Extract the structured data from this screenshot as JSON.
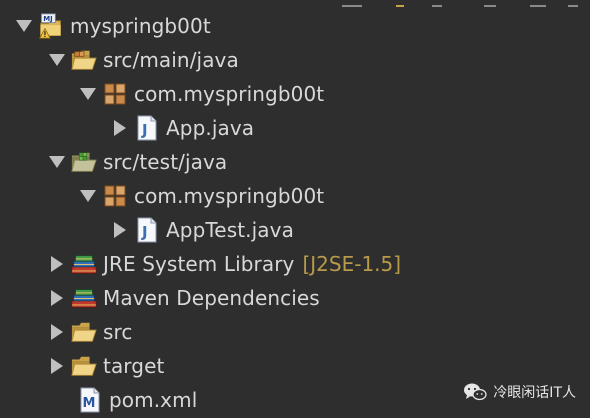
{
  "tree": {
    "project": {
      "label": "myspringb00t",
      "icon": "maven-project-warning-icon",
      "expanded": true
    },
    "src_main_java": {
      "label": "src/main/java",
      "icon": "source-folder-icon",
      "expanded": true
    },
    "pkg_main": {
      "label": "com.myspringb00t",
      "icon": "package-icon",
      "expanded": true
    },
    "app_java": {
      "label": "App.java",
      "icon": "java-file-icon",
      "expanded": false
    },
    "src_test_java": {
      "label": "src/test/java",
      "icon": "test-source-folder-icon",
      "expanded": true
    },
    "pkg_test": {
      "label": "com.myspringb00t",
      "icon": "package-icon",
      "expanded": true
    },
    "apptest_java": {
      "label": "AppTest.java",
      "icon": "java-file-icon",
      "expanded": false
    },
    "jre": {
      "label": "JRE System Library",
      "suffix": "[J2SE-1.5]",
      "icon": "library-icon",
      "expanded": false
    },
    "maven_deps": {
      "label": "Maven Dependencies",
      "icon": "library-icon",
      "expanded": false
    },
    "src": {
      "label": "src",
      "icon": "folder-icon",
      "expanded": false
    },
    "target": {
      "label": "target",
      "icon": "folder-icon",
      "expanded": false
    },
    "pom": {
      "label": "pom.xml",
      "icon": "maven-pom-icon"
    }
  },
  "watermark": {
    "text": "冷眼闲话IT人",
    "icon": "wechat-icon"
  },
  "colors": {
    "background": "#2e2e2e",
    "text": "#d8d8d8",
    "suffix": "#b89a4a",
    "twisty": "#bfbfbf",
    "folder": "#e8c56a",
    "package": "#c98a4a",
    "java_blue": "#3a6fb0"
  }
}
